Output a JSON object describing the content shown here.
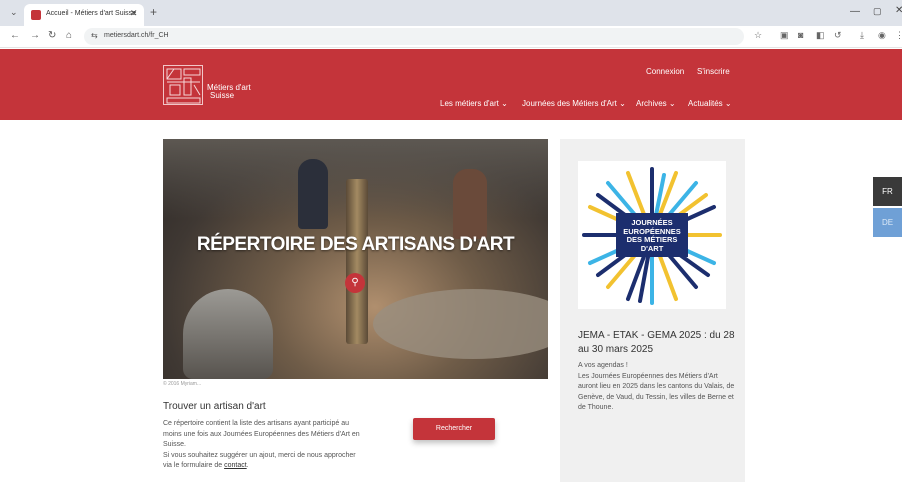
{
  "browser": {
    "tab_title": "Accueil - Métiers d'art Suisse",
    "tab_close": "✕",
    "new_tab": "+",
    "url": "metiersdart.ch/fr_CH",
    "window": {
      "minimize": "—",
      "maximize": "▢",
      "close": "✕"
    }
  },
  "header": {
    "brand_line1": "Métiers d'art",
    "brand_line2": "Suisse",
    "login": "Connexion",
    "signup": "S'inscrire",
    "menu": [
      "Les métiers d'art ⌄",
      "Journées des Métiers d'Art ⌄",
      "Archives ⌄",
      "Actualités ⌄"
    ]
  },
  "hero": {
    "title": "RÉPERTOIRE DES ARTISANS D'ART",
    "credit": "© 2016 Myriam..."
  },
  "finder": {
    "title": "Trouver un artisan d'art",
    "desc_line1": "Ce répertoire contient la liste des artisans ayant participé au moins une fois aux Journées Européennes des Métiers d'Art en Suisse.",
    "desc_line2_prefix": "Si vous souhaitez suggérer un ajout, merci de nous approcher via le formulaire de ",
    "contact_link": "contact",
    "desc_line2_suffix": ".",
    "button": "Rechercher"
  },
  "sidebar": {
    "logo_lines": [
      "JOURNÉES",
      "EUROPÉENNES",
      "DES MÉTIERS",
      "D'ART"
    ],
    "title": "JEMA - ETAK - GEMA 2025 : du 28 au 30 mars 2025",
    "body_line1": "A vos agendas !",
    "body_line2": "Les Journées Européennes des Métiers d'Art auront lieu en 2025 dans les cantons du Valais, de Genève, de Vaud, du Tessin, les villes de Berne et de Thoune."
  },
  "languages": {
    "fr": "FR",
    "de": "DE"
  },
  "colors": {
    "brand": "#c4343a",
    "jema_blue": "#1c2e6e",
    "jema_yellow": "#f2c230",
    "jema_cyan": "#3cb4e6"
  }
}
